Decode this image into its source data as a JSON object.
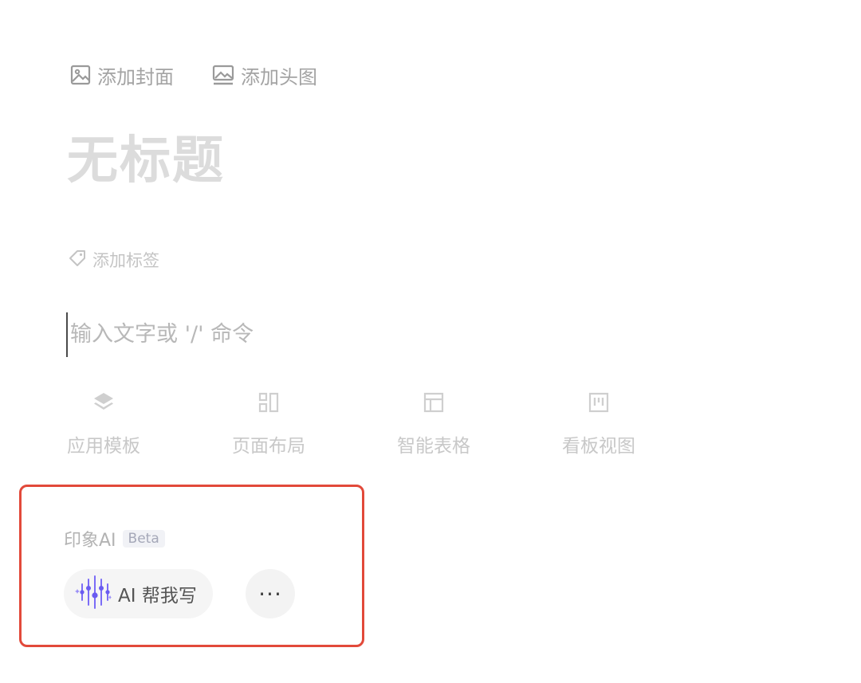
{
  "header_actions": {
    "add_cover": "添加封面",
    "add_banner": "添加头图"
  },
  "title": {
    "placeholder": "无标题"
  },
  "tags": {
    "add_tag": "添加标签"
  },
  "editor": {
    "placeholder": "输入文字或 '/' 命令"
  },
  "quick_actions": [
    {
      "label": "应用模板",
      "icon": "layers-icon"
    },
    {
      "label": "页面布局",
      "icon": "layout-icon"
    },
    {
      "label": "智能表格",
      "icon": "table-icon"
    },
    {
      "label": "看板视图",
      "icon": "kanban-icon"
    }
  ],
  "ai_panel": {
    "title": "印象AI",
    "badge": "Beta",
    "write_button": "AI 帮我写",
    "more_button": "···",
    "highlight_color": "#e2493a",
    "accent_color": "#7b6cf6"
  }
}
